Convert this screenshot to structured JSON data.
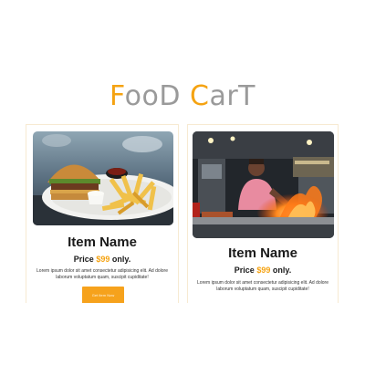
{
  "brand": {
    "title_parts": [
      {
        "text": "F",
        "style": "accent"
      },
      {
        "text": "ooD ",
        "style": "muted"
      },
      {
        "text": "C",
        "style": "accent"
      },
      {
        "text": "arT",
        "style": "muted"
      }
    ]
  },
  "colors": {
    "accent": "#f5a312",
    "muted_text": "#9a9a9a",
    "card_border": "#f7ead2",
    "button_bg": "#f6a21c"
  },
  "cards": [
    {
      "image_icon": "burger-fries-photo",
      "name": "Item Name",
      "price_prefix": "Price ",
      "price_amount": "$99",
      "price_suffix": " only.",
      "description": "Lorem ipsum dolor sit amet consectetur adipisicing elit. Ad dolore laborum voluptatum quam, suscipit cupiditate!",
      "button_label": "Get Item Now"
    },
    {
      "image_icon": "street-food-chef-photo",
      "name": "Item Name",
      "price_prefix": "Price ",
      "price_amount": "$99",
      "price_suffix": " only.",
      "description": "Lorem ipsum dolor sit amet consectetur adipisicing elit. Ad dolore laborum voluptatum quam, suscipit cupiditate!"
    }
  ]
}
